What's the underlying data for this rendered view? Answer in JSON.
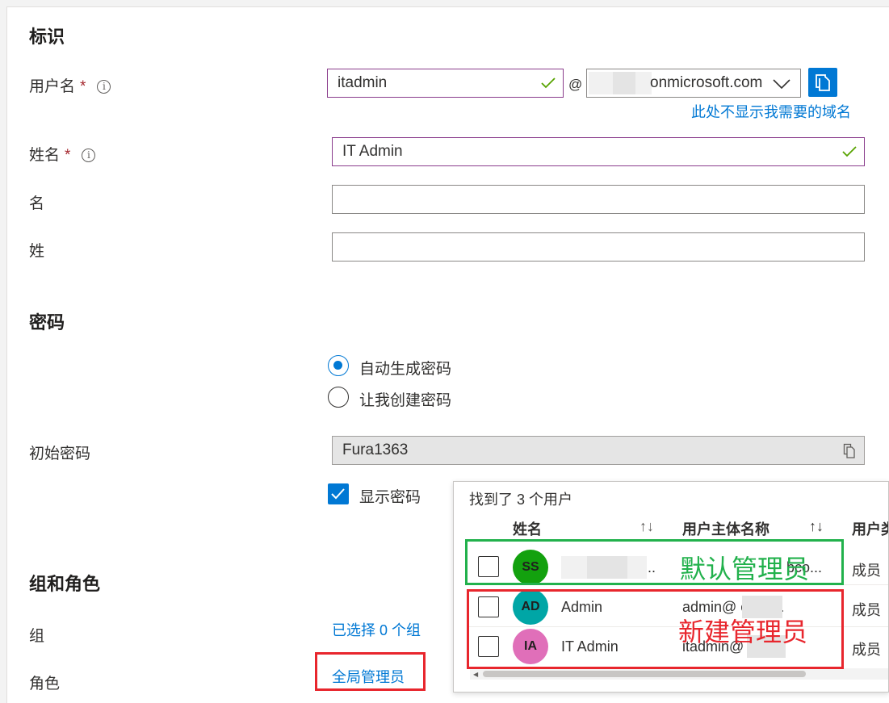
{
  "identity": {
    "section_title": "标识",
    "username_label": "用户名",
    "required_mark": "*",
    "info_glyph": "i",
    "username_value": "itadmin",
    "at_sign": "@",
    "domain_value": "onmicrosoft.com",
    "domain_link": "此处不显示我需要的域名",
    "fullname_label": "姓名",
    "fullname_value": "IT Admin",
    "given_name_label": "名",
    "surname_label": "姓"
  },
  "password": {
    "section_title": "密码",
    "option_auto": "自动生成密码",
    "option_manual": "让我创建密码",
    "selected": "auto",
    "initial_label": "初始密码",
    "initial_value": "Fura1363",
    "show_password_label": "显示密码",
    "show_password_checked": true
  },
  "groups": {
    "section_title": "组和角色",
    "group_label": "组",
    "group_link": "已选择 0 个组",
    "role_label": "角色",
    "role_link": "全局管理员"
  },
  "popup": {
    "found_text": "找到了 3 个用户",
    "col_name": "姓名",
    "col_upn": "用户主体名称",
    "col_type": "用户类",
    "sort_glyph": "↑↓",
    "rows": [
      {
        "initials": "SS",
        "avatar_color": "#13a10e",
        "name": "..",
        "upn": "bco...",
        "type": "成员"
      },
      {
        "initials": "AD",
        "avatar_color": "#00a6a6",
        "name": "Admin",
        "upn": "admin@       onmi...",
        "type": "成员"
      },
      {
        "initials": "IA",
        "avatar_color": "#e06fb9",
        "name": "IT Admin",
        "upn": "itadmin@       .on...",
        "type": "成员"
      }
    ]
  },
  "annotations": {
    "default_admin": "默认管理员",
    "default_admin_color": "#22b14c",
    "new_admin": "新建管理员",
    "new_admin_color": "#e8262d"
  },
  "colors": {
    "accent": "#0078d4",
    "valid_border": "#8a3c8c",
    "check": "#57a300"
  },
  "icons": [
    "info-icon",
    "checkmark-icon",
    "chevron-down-icon",
    "copy-icon",
    "sort-icon"
  ]
}
